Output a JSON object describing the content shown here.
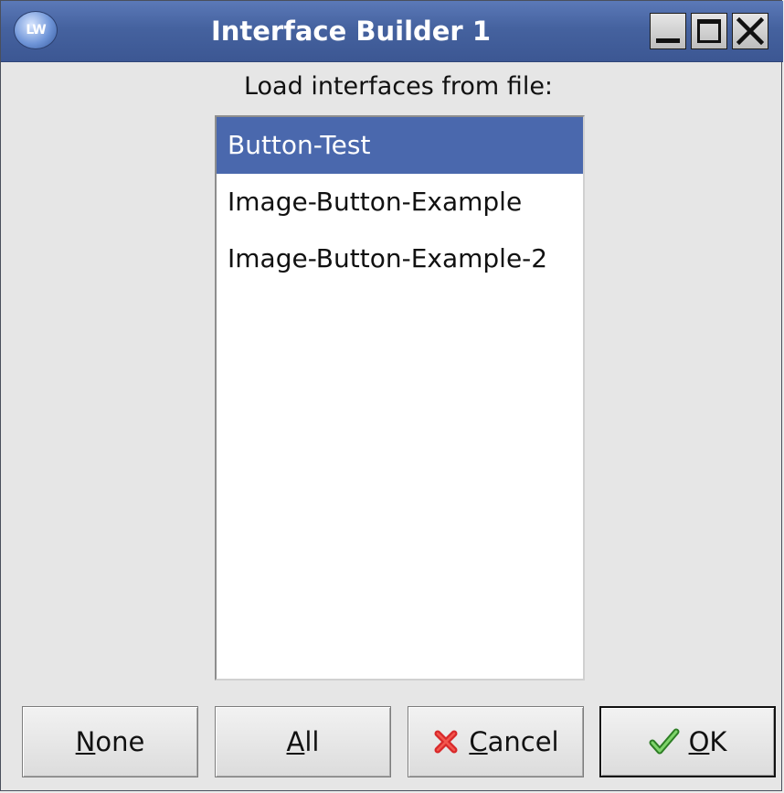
{
  "window": {
    "title": "Interface Builder 1",
    "logo_text": "LW",
    "controls": {
      "minimize_icon": "minimize-icon",
      "maximize_icon": "maximize-icon",
      "close_icon": "close-icon"
    }
  },
  "dialog": {
    "prompt": "Load interfaces from file:",
    "list": {
      "items": [
        {
          "label": "Button-Test",
          "selected": true
        },
        {
          "label": "Image-Button-Example",
          "selected": false
        },
        {
          "label": "Image-Button-Example-2",
          "selected": false
        }
      ]
    },
    "buttons": {
      "none": {
        "mnemonic": "N",
        "rest": "one"
      },
      "all": {
        "mnemonic": "A",
        "rest": "ll"
      },
      "cancel": {
        "mnemonic": "C",
        "rest": "ancel",
        "icon": "cancel-x-icon"
      },
      "ok": {
        "mnemonic": "O",
        "rest": "K",
        "icon": "checkmark-icon"
      }
    }
  },
  "colors": {
    "titlebar": "#45629f",
    "selection": "#4a68ad",
    "cancel_icon": "#d8292b",
    "ok_icon": "#3aa02e"
  }
}
